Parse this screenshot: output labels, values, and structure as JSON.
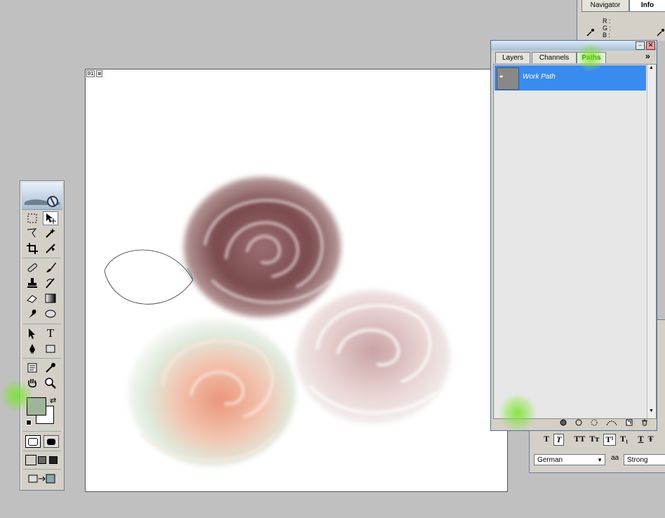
{
  "document": {
    "tab_index": "01"
  },
  "toolbox": {
    "tools": [
      {
        "name": "marquee-tool-icon"
      },
      {
        "name": "move-tool-icon"
      },
      {
        "name": "lasso-tool-icon"
      },
      {
        "name": "magic-wand-tool-icon"
      },
      {
        "name": "crop-tool-icon"
      },
      {
        "name": "slice-tool-icon"
      },
      {
        "name": "healing-brush-tool-icon"
      },
      {
        "name": "brush-tool-icon"
      },
      {
        "name": "clone-stamp-tool-icon"
      },
      {
        "name": "history-brush-tool-icon"
      },
      {
        "name": "eraser-tool-icon"
      },
      {
        "name": "gradient-tool-icon"
      },
      {
        "name": "blur-tool-icon"
      },
      {
        "name": "dodge-tool-icon"
      },
      {
        "name": "path-selection-tool-icon"
      },
      {
        "name": "type-tool-icon"
      },
      {
        "name": "pen-tool-icon"
      },
      {
        "name": "shape-tool-icon"
      },
      {
        "name": "notes-tool-icon"
      },
      {
        "name": "eyedropper-tool-icon"
      },
      {
        "name": "hand-tool-icon"
      },
      {
        "name": "zoom-tool-icon"
      }
    ],
    "type_tool_label": "T",
    "foreground_color": "#9fb59a",
    "background_color": "#ffffff"
  },
  "info_panel": {
    "tabs": [
      "Navigator",
      "Info"
    ],
    "active_tab": "Info",
    "labels": [
      "R :",
      "G :",
      "B :"
    ]
  },
  "paths_panel": {
    "tabs": [
      "Layers",
      "Channels",
      "Paths"
    ],
    "active_tab": "Paths",
    "menu_glyph": "»",
    "paths": [
      {
        "label": "Work Path"
      }
    ],
    "selection_color": "#3a8bef"
  },
  "character_panel": {
    "language": "German",
    "antialias": "Strong",
    "antialias_icon_label": "aa",
    "style_buttons": [
      "T",
      "T",
      "TT",
      "Tт",
      "T¹",
      "T₁",
      "T",
      "Ŧ"
    ]
  },
  "highlight_color": "#78e628"
}
